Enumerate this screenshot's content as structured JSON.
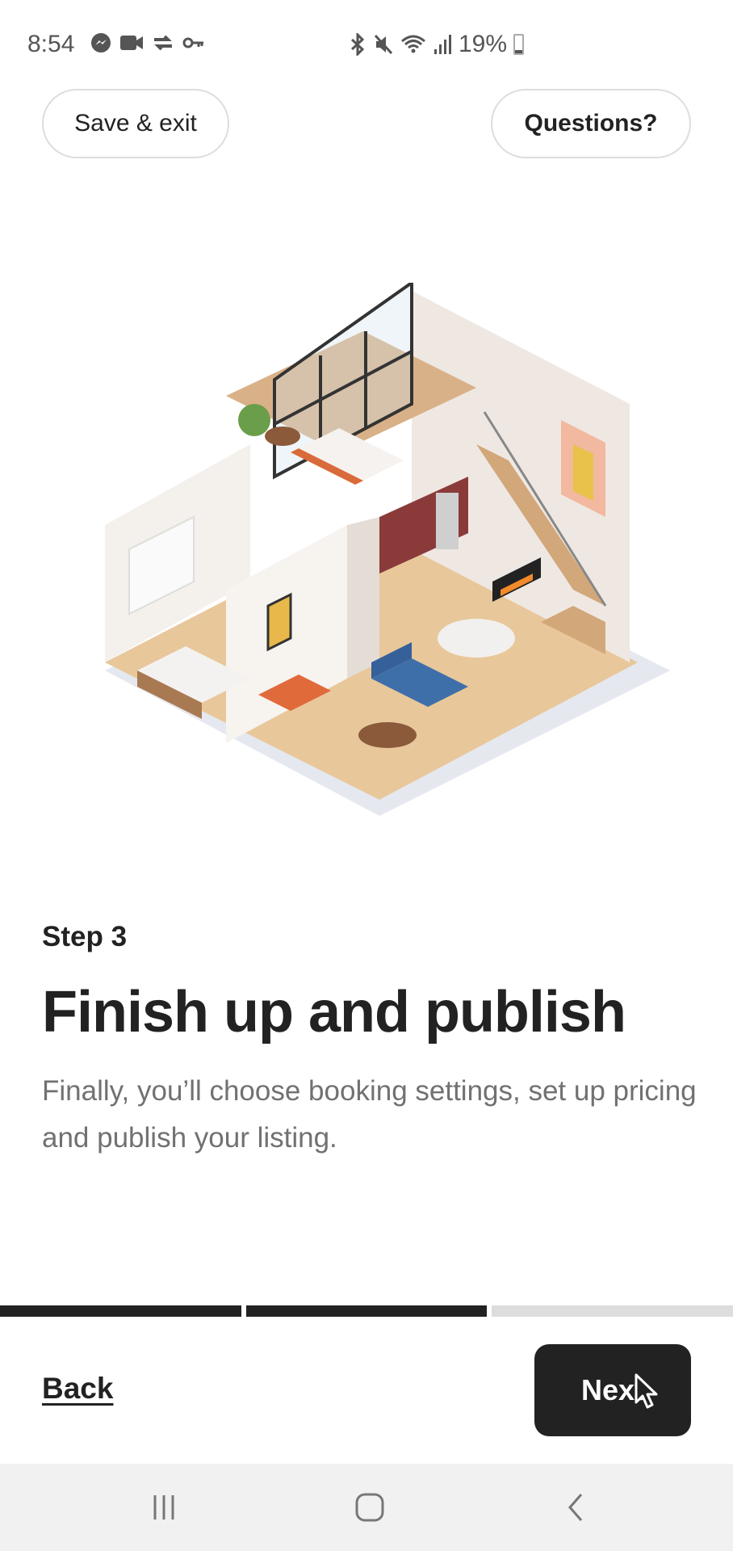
{
  "status_bar": {
    "time": "8:54",
    "left_icons": [
      "messenger-icon",
      "video-camera-icon",
      "sync-check-icon",
      "key-icon"
    ],
    "right_icons": [
      "bluetooth-icon",
      "mute-icon",
      "wifi-icon",
      "signal-icon"
    ],
    "battery_percent": "19%",
    "battery_level": 0.19
  },
  "header": {
    "save_exit_label": "Save & exit",
    "questions_label": "Questions?"
  },
  "illustration": {
    "description": "Isometric cutaway of a two-story loft home"
  },
  "content": {
    "step_label": "Step 3",
    "title": "Finish up and publish",
    "description": "Finally, you’ll choose booking settings, set up pricing and publish your listing."
  },
  "progress": {
    "segments": 3,
    "completed": 2
  },
  "footer": {
    "back_label": "Back",
    "next_label": "Next"
  },
  "colors": {
    "primary": "#222222",
    "muted_text": "#717171",
    "progress_inactive": "#dddddd",
    "nav_bar": "#f1f1f1"
  }
}
